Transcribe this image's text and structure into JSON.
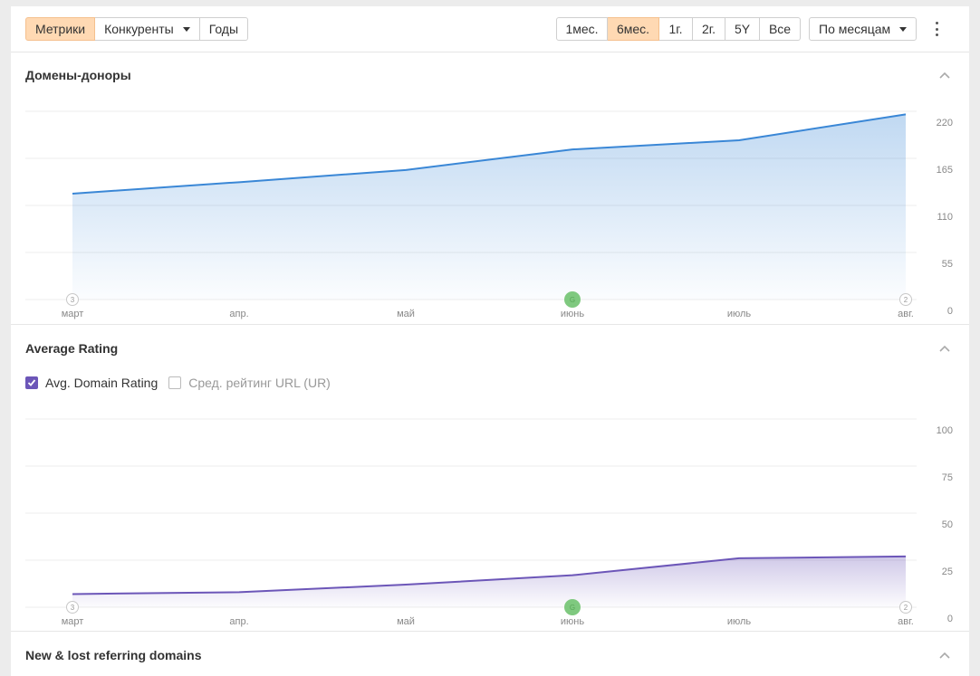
{
  "toolbar": {
    "tabs": [
      {
        "label": "Метрики",
        "active": true
      },
      {
        "label": "Конкуренты",
        "dropdown": true
      },
      {
        "label": "Годы"
      }
    ],
    "periods": [
      {
        "label": "1мес."
      },
      {
        "label": "6мес.",
        "active": true
      },
      {
        "label": "1г."
      },
      {
        "label": "2г."
      },
      {
        "label": "5Y"
      },
      {
        "label": "Все"
      }
    ],
    "grouping": "По месяцам",
    "more_icon": "kebab-menu-icon",
    "accent_color": "#ffd9b3"
  },
  "sections": {
    "referring": {
      "title": "Домены-доноры",
      "collapse_icon": "chevron-up-icon"
    },
    "rating": {
      "title": "Average Rating",
      "collapse_icon": "chevron-up-icon",
      "legend": [
        {
          "label": "Avg. Domain Rating",
          "checked": true,
          "color": "#6c56b8"
        },
        {
          "label": "Сред. рейтинг URL (UR)",
          "checked": false
        }
      ]
    },
    "newlost": {
      "title": "New & lost referring domains",
      "collapse_icon": "chevron-up-icon"
    }
  },
  "chart_data": [
    {
      "type": "area",
      "title": "Домены-доноры",
      "categories": [
        "март",
        "апр.",
        "май",
        "июнь",
        "июль",
        "авг."
      ],
      "series": [
        {
          "values": [
            139,
            154,
            170,
            197,
            209,
            243
          ],
          "color": "#3a87d6"
        }
      ],
      "yticks": [
        0,
        55,
        110,
        165,
        220
      ],
      "ylim": [
        0,
        247
      ],
      "grid": true,
      "markers": [
        {
          "category": "март",
          "text": "3",
          "style": "outline"
        },
        {
          "category": "июнь",
          "text": "G",
          "style": "green"
        },
        {
          "category": "авг.",
          "text": "2",
          "style": "outline"
        }
      ]
    },
    {
      "type": "area",
      "title": "Average Rating",
      "categories": [
        "март",
        "апр.",
        "май",
        "июнь",
        "июль",
        "авг."
      ],
      "series": [
        {
          "name": "Avg. Domain Rating",
          "values": [
            7,
            8,
            12,
            17,
            26,
            27
          ],
          "color": "#6c56b8"
        }
      ],
      "yticks": [
        0,
        25,
        50,
        75,
        100
      ],
      "ylim": [
        0,
        100
      ],
      "grid": true,
      "markers": [
        {
          "category": "март",
          "text": "3",
          "style": "outline"
        },
        {
          "category": "июнь",
          "text": "G",
          "style": "green"
        },
        {
          "category": "авг.",
          "text": "2",
          "style": "outline"
        }
      ]
    }
  ]
}
